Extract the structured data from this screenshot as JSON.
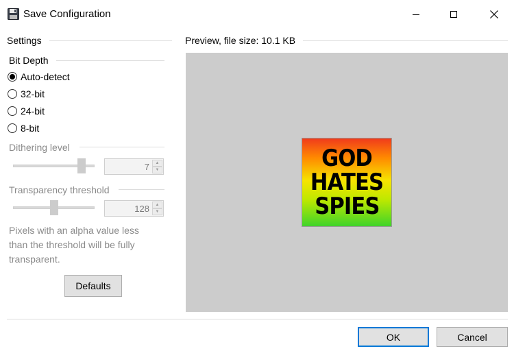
{
  "window": {
    "title": "Save Configuration",
    "icon": "floppy-disk-icon",
    "controls": [
      "minimize-icon",
      "maximize-icon",
      "close-icon"
    ]
  },
  "settings": {
    "label": "Settings",
    "bit_depth": {
      "label": "Bit Depth",
      "options": [
        "Auto-detect",
        "32-bit",
        "24-bit",
        "8-bit"
      ],
      "selected": "Auto-detect"
    },
    "dithering": {
      "label": "Dithering level",
      "value": "7",
      "slider_fraction": 0.88
    },
    "transparency": {
      "label": "Transparency threshold",
      "value": "128",
      "slider_fraction": 0.5
    },
    "help_text": "Pixels with an alpha value less than the threshold will be fully transparent.",
    "defaults_label": "Defaults"
  },
  "preview": {
    "label": "Preview, file size: 10.1 KB",
    "image_text": [
      "GOD",
      "HATES",
      "SPIES"
    ]
  },
  "footer": {
    "ok_label": "OK",
    "cancel_label": "Cancel"
  },
  "colors": {
    "accent": "#0078d7",
    "preview_bg": "#cccccc",
    "disabled_text": "#8a8a8a"
  }
}
